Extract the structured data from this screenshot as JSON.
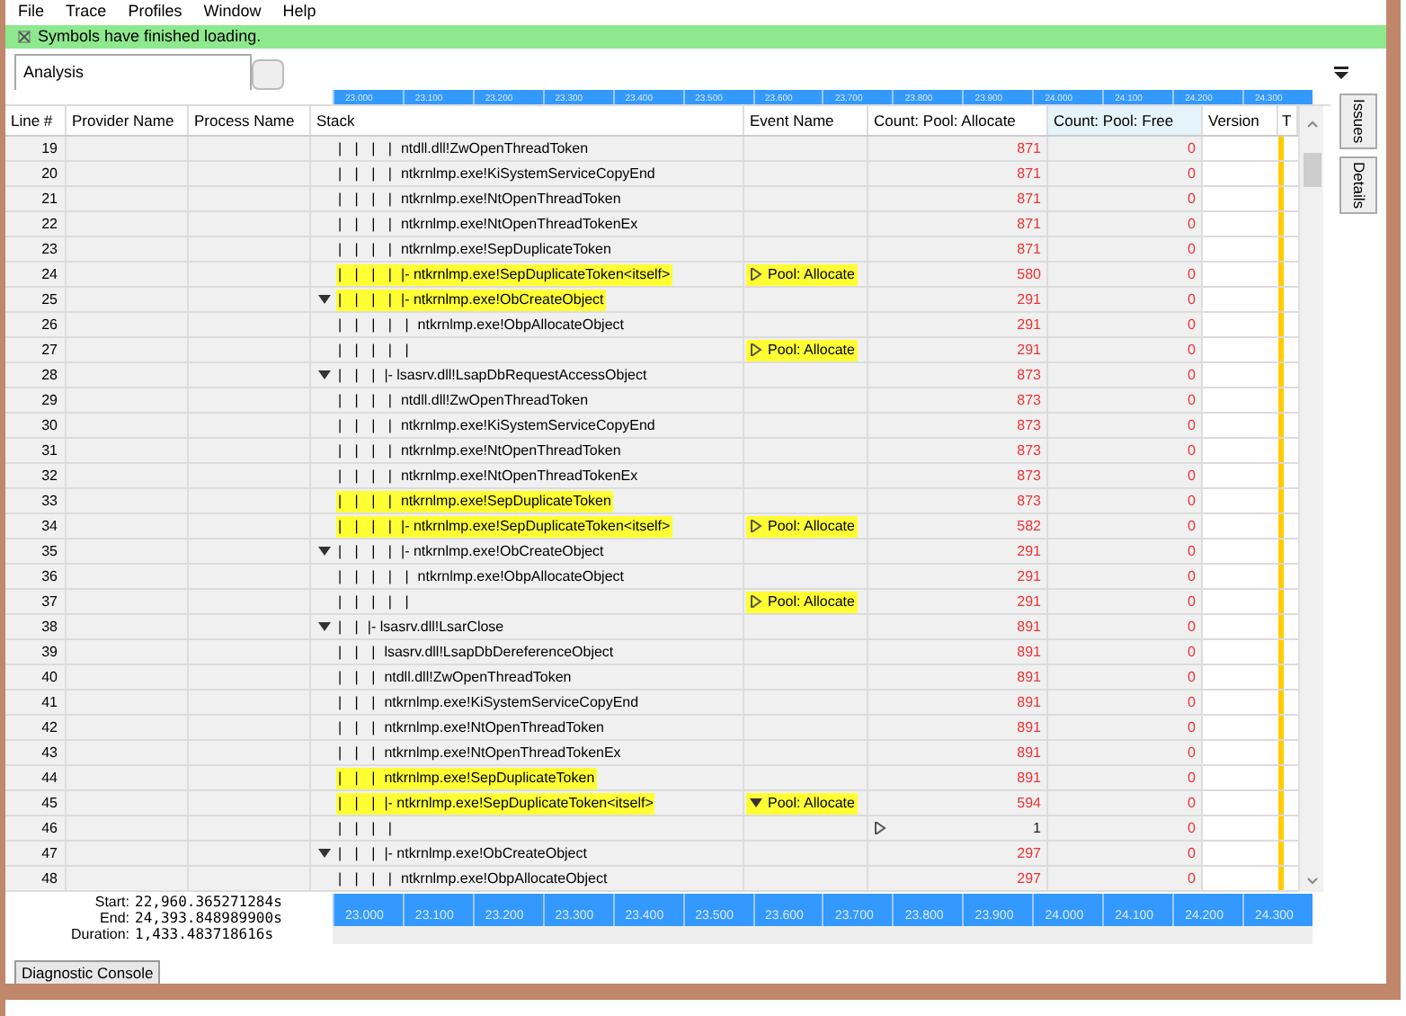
{
  "menu": [
    "File",
    "Trace",
    "Profiles",
    "Window",
    "Help"
  ],
  "notification": {
    "text": "Symbols have finished loading."
  },
  "tabs": [
    {
      "label": "Analysis",
      "selected": true
    }
  ],
  "top_ruler_ticks": [
    "23.000",
    "23.100",
    "23.200",
    "23.300",
    "23.400",
    "23.500",
    "23.600",
    "23.700",
    "23.800",
    "23.900",
    "24.000",
    "24.100",
    "24.200",
    "24.300"
  ],
  "bottom_ruler_ticks": [
    "23.000",
    "23.100",
    "23.200",
    "23.300",
    "23.400",
    "23.500",
    "23.600",
    "23.700",
    "23.800",
    "23.900",
    "24.000",
    "24.100",
    "24.200",
    "24.300"
  ],
  "side_tabs": [
    "Issues",
    "Details"
  ],
  "table": {
    "columns": [
      "Line #",
      "Provider Name",
      "Process Name",
      "Stack",
      "Event Name",
      "Count: Pool: Allocate",
      "Count: Pool: Free",
      "Version",
      "T"
    ],
    "rows": [
      {
        "line": "19",
        "has_children": false,
        "highlighted": false,
        "tree": "| | | |",
        "frame": "ntdll.dll!ZwOpenThreadToken",
        "alloc": "871",
        "free": "0"
      },
      {
        "line": "20",
        "has_children": false,
        "highlighted": false,
        "tree": "| | | |",
        "frame": "ntkrnlmp.exe!KiSystemServiceCopyEnd",
        "alloc": "871",
        "free": "0"
      },
      {
        "line": "21",
        "has_children": false,
        "highlighted": false,
        "tree": "| | | |",
        "frame": "ntkrnlmp.exe!NtOpenThreadToken",
        "alloc": "871",
        "free": "0"
      },
      {
        "line": "22",
        "has_children": false,
        "highlighted": false,
        "tree": "| | | |",
        "frame": "ntkrnlmp.exe!NtOpenThreadTokenEx",
        "alloc": "871",
        "free": "0"
      },
      {
        "line": "23",
        "has_children": false,
        "highlighted": false,
        "tree": "| | | |",
        "frame": "ntkrnlmp.exe!SepDuplicateToken",
        "alloc": "871",
        "free": "0"
      },
      {
        "line": "24",
        "has_children": false,
        "highlighted": true,
        "tree": "| | | |",
        "frame": "|- ntkrnlmp.exe!SepDuplicateToken<itself>",
        "event": {
          "label": "Pool: Allocate",
          "expanded": false
        },
        "alloc": "580",
        "free": "0"
      },
      {
        "line": "25",
        "has_children": true,
        "highlighted": true,
        "tree": "| | | |",
        "frame": "|- ntkrnlmp.exe!ObCreateObject",
        "alloc": "291",
        "free": "0"
      },
      {
        "line": "26",
        "has_children": false,
        "highlighted": false,
        "tree": "| | | | |",
        "frame": "ntkrnlmp.exe!ObpAllocateObject",
        "alloc": "291",
        "free": "0"
      },
      {
        "line": "27",
        "has_children": false,
        "highlighted": false,
        "tree": "| | | | |",
        "event": {
          "label": "Pool: Allocate",
          "expanded": false
        },
        "alloc": "291",
        "free": "0"
      },
      {
        "line": "28",
        "has_children": true,
        "highlighted": false,
        "tree": "| | |",
        "frame": "|- lsasrv.dll!LsapDbRequestAccessObject",
        "alloc": "873",
        "free": "0"
      },
      {
        "line": "29",
        "has_children": false,
        "highlighted": false,
        "tree": "| | | |",
        "frame": "ntdll.dll!ZwOpenThreadToken",
        "alloc": "873",
        "free": "0"
      },
      {
        "line": "30",
        "has_children": false,
        "highlighted": false,
        "tree": "| | | |",
        "frame": "ntkrnlmp.exe!KiSystemServiceCopyEnd",
        "alloc": "873",
        "free": "0"
      },
      {
        "line": "31",
        "has_children": false,
        "highlighted": false,
        "tree": "| | | |",
        "frame": "ntkrnlmp.exe!NtOpenThreadToken",
        "alloc": "873",
        "free": "0"
      },
      {
        "line": "32",
        "has_children": false,
        "highlighted": false,
        "tree": "| | | |",
        "frame": "ntkrnlmp.exe!NtOpenThreadTokenEx",
        "alloc": "873",
        "free": "0"
      },
      {
        "line": "33",
        "has_children": false,
        "highlighted": true,
        "tree": "| | | |",
        "frame": "ntkrnlmp.exe!SepDuplicateToken",
        "alloc": "873",
        "free": "0"
      },
      {
        "line": "34",
        "has_children": false,
        "highlighted": true,
        "tree": "| | | |",
        "frame": "|- ntkrnlmp.exe!SepDuplicateToken<itself>",
        "event": {
          "label": "Pool: Allocate",
          "expanded": false
        },
        "alloc": "582",
        "free": "0"
      },
      {
        "line": "35",
        "has_children": true,
        "highlighted": false,
        "tree": "| | | |",
        "frame": "|- ntkrnlmp.exe!ObCreateObject",
        "alloc": "291",
        "free": "0"
      },
      {
        "line": "36",
        "has_children": false,
        "highlighted": false,
        "tree": "| | | | |",
        "frame": "ntkrnlmp.exe!ObpAllocateObject",
        "alloc": "291",
        "free": "0"
      },
      {
        "line": "37",
        "has_children": false,
        "highlighted": false,
        "tree": "| | | | |",
        "event": {
          "label": "Pool: Allocate",
          "expanded": false
        },
        "alloc": "291",
        "free": "0"
      },
      {
        "line": "38",
        "has_children": true,
        "highlighted": false,
        "tree": "| |",
        "frame": "|- lsasrv.dll!LsarClose",
        "alloc": "891",
        "free": "0"
      },
      {
        "line": "39",
        "has_children": false,
        "highlighted": false,
        "tree": "| | |",
        "frame": "lsasrv.dll!LsapDbDereferenceObject",
        "alloc": "891",
        "free": "0"
      },
      {
        "line": "40",
        "has_children": false,
        "highlighted": false,
        "tree": "| | |",
        "frame": "ntdll.dll!ZwOpenThreadToken",
        "alloc": "891",
        "free": "0"
      },
      {
        "line": "41",
        "has_children": false,
        "highlighted": false,
        "tree": "| | |",
        "frame": "ntkrnlmp.exe!KiSystemServiceCopyEnd",
        "alloc": "891",
        "free": "0"
      },
      {
        "line": "42",
        "has_children": false,
        "highlighted": false,
        "tree": "| | |",
        "frame": "ntkrnlmp.exe!NtOpenThreadToken",
        "alloc": "891",
        "free": "0"
      },
      {
        "line": "43",
        "has_children": false,
        "highlighted": false,
        "tree": "| | |",
        "frame": "ntkrnlmp.exe!NtOpenThreadTokenEx",
        "alloc": "891",
        "free": "0"
      },
      {
        "line": "44",
        "has_children": false,
        "highlighted": true,
        "tree": "| | |",
        "frame": "ntkrnlmp.exe!SepDuplicateToken",
        "alloc": "891",
        "free": "0"
      },
      {
        "line": "45",
        "has_children": false,
        "highlighted": true,
        "tree": "| | |",
        "frame": "|- ntkrnlmp.exe!SepDuplicateToken<itself>",
        "event": {
          "label": "Pool: Allocate",
          "expanded": true
        },
        "alloc": "594",
        "free": "0"
      },
      {
        "line": "46",
        "has_children": false,
        "highlighted": false,
        "tree": "| | | |",
        "alloc": "1",
        "alloc_expandable": true,
        "free": "0"
      },
      {
        "line": "47",
        "has_children": true,
        "highlighted": false,
        "tree": "| | |",
        "frame": "|- ntkrnlmp.exe!ObCreateObject",
        "alloc": "297",
        "free": "0"
      },
      {
        "line": "48",
        "has_children": false,
        "highlighted": false,
        "tree": "| | | |",
        "frame": "ntkrnlmp.exe!ObpAllocateObject",
        "alloc": "297",
        "free": "0"
      }
    ]
  },
  "time_range": [
    {
      "label": "Start:",
      "value": "22,960.365271284s"
    },
    {
      "label": "End:",
      "value": "24,393.848989900s"
    },
    {
      "label": "Duration:",
      "value": "1,433.483718616s"
    }
  ],
  "footer_button": "Diagnostic Console"
}
